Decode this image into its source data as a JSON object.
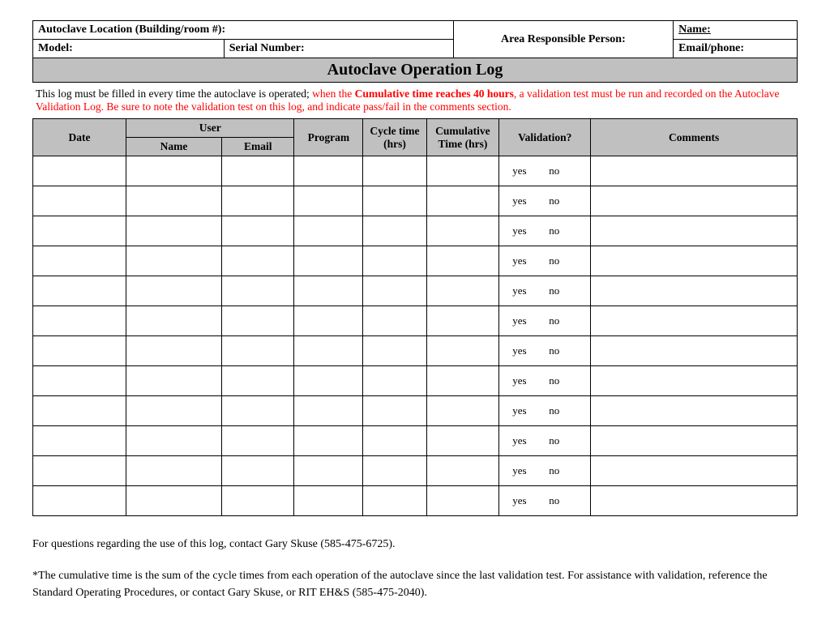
{
  "info": {
    "location_label": "Autoclave Location (Building/room #):",
    "model_label": "Model:",
    "serial_label": "Serial Number:",
    "area_resp_label": "Area Responsible Person:",
    "name_label": "Name:",
    "emailphone_label": "Email/phone:"
  },
  "title": "Autoclave Operation Log",
  "instructions": {
    "black1": "This log must be filled in every time the autoclave is operated; ",
    "red1": "when the ",
    "redbold": "Cumulative time reaches 40 hours",
    "red2": ", a validation test must be run and recorded on the Autoclave Validation Log. Be sure to note the validation test on this log, and indicate pass/fail in the comments section."
  },
  "headers": {
    "date": "Date",
    "user": "User",
    "name": "Name",
    "email": "Email",
    "program": "Program",
    "cycle": "Cycle time (hrs)",
    "cumulative": "Cumulative Time (hrs)",
    "validation": "Validation?",
    "comments": "Comments"
  },
  "row": {
    "yes": "yes",
    "no": "no"
  },
  "row_count": 12,
  "footer": {
    "p1": "For questions regarding the use of this log, contact Gary Skuse (585-475-6725).",
    "p2": "*The cumulative time is the sum of the cycle times from each operation of the autoclave since the last validation test.  For assistance with validation, reference the Standard Operating Procedures, or contact Gary Skuse, or RIT EH&S (585-475-2040)."
  }
}
